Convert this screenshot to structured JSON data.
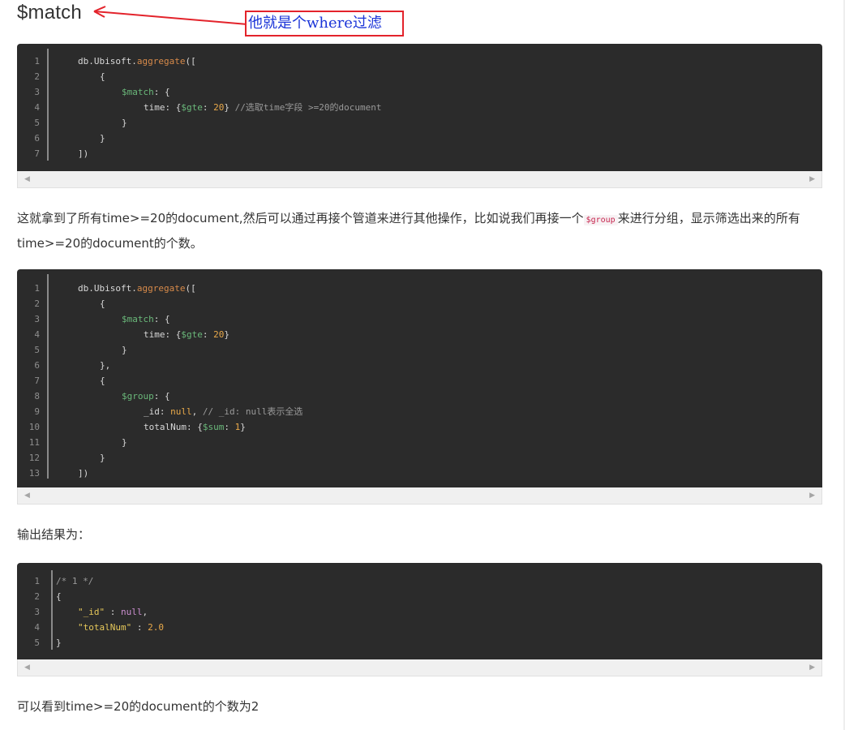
{
  "heading": "$match",
  "annotation": {
    "text": "他就是个where过滤",
    "arrow_color": "#e3232b",
    "text_color": "#1b35d8"
  },
  "code_blocks": [
    {
      "line_numbers": [
        "1",
        "2",
        "3",
        "4",
        "5",
        "6",
        "7"
      ],
      "lines": [
        [
          {
            "t": "db.Ubisoft.",
            "c": "plain"
          },
          {
            "t": "aggregate",
            "c": "func"
          },
          {
            "t": "([",
            "c": "plain"
          }
        ],
        [
          {
            "t": "{",
            "c": "plain"
          }
        ],
        [
          {
            "t": "$match",
            "c": "key"
          },
          {
            "t": ": {",
            "c": "plain"
          }
        ],
        [
          {
            "t": "time: {",
            "c": "plain"
          },
          {
            "t": "$gte",
            "c": "key"
          },
          {
            "t": ": ",
            "c": "plain"
          },
          {
            "t": "20",
            "c": "num"
          },
          {
            "t": "} ",
            "c": "plain"
          },
          {
            "t": "//选取time字段 >=20的document",
            "c": "cmt"
          }
        ],
        [
          {
            "t": "}",
            "c": "plain"
          }
        ],
        [
          {
            "t": "}",
            "c": "plain"
          }
        ],
        [
          {
            "t": "])",
            "c": "plain"
          }
        ]
      ],
      "indent": [
        1,
        2,
        3,
        4,
        3,
        2,
        1
      ]
    },
    {
      "line_numbers": [
        "1",
        "2",
        "3",
        "4",
        "5",
        "6",
        "7",
        "8",
        "9",
        "10",
        "11",
        "12",
        "13"
      ],
      "lines": [
        [
          {
            "t": "db.Ubisoft.",
            "c": "plain"
          },
          {
            "t": "aggregate",
            "c": "func"
          },
          {
            "t": "([",
            "c": "plain"
          }
        ],
        [
          {
            "t": "{",
            "c": "plain"
          }
        ],
        [
          {
            "t": "$match",
            "c": "key"
          },
          {
            "t": ": {",
            "c": "plain"
          }
        ],
        [
          {
            "t": "time: {",
            "c": "plain"
          },
          {
            "t": "$gte",
            "c": "key"
          },
          {
            "t": ": ",
            "c": "plain"
          },
          {
            "t": "20",
            "c": "num"
          },
          {
            "t": "}",
            "c": "plain"
          }
        ],
        [
          {
            "t": "}",
            "c": "plain"
          }
        ],
        [
          {
            "t": "},",
            "c": "plain"
          }
        ],
        [
          {
            "t": "{",
            "c": "plain"
          }
        ],
        [
          {
            "t": "$group",
            "c": "key"
          },
          {
            "t": ": {",
            "c": "plain"
          }
        ],
        [
          {
            "t": "_id: ",
            "c": "plain"
          },
          {
            "t": "null",
            "c": "num"
          },
          {
            "t": ", ",
            "c": "plain"
          },
          {
            "t": "// _id: null表示全选",
            "c": "cmt"
          }
        ],
        [
          {
            "t": "totalNum: {",
            "c": "plain"
          },
          {
            "t": "$sum",
            "c": "key"
          },
          {
            "t": ": ",
            "c": "plain"
          },
          {
            "t": "1",
            "c": "num"
          },
          {
            "t": "}",
            "c": "plain"
          }
        ],
        [
          {
            "t": "}",
            "c": "plain"
          }
        ],
        [
          {
            "t": "}",
            "c": "plain"
          }
        ],
        [
          {
            "t": "])",
            "c": "plain"
          }
        ]
      ],
      "indent": [
        1,
        2,
        3,
        4,
        3,
        2,
        2,
        3,
        4,
        4,
        3,
        2,
        1
      ]
    },
    {
      "line_numbers": [
        "1",
        "2",
        "3",
        "4",
        "5"
      ],
      "lines": [
        [
          {
            "t": "/* 1 */",
            "c": "cmt"
          }
        ],
        [
          {
            "t": "{",
            "c": "plain"
          }
        ],
        [
          {
            "t": "\"_id\"",
            "c": "str"
          },
          {
            "t": " : ",
            "c": "plain"
          },
          {
            "t": "null",
            "c": "null"
          },
          {
            "t": ",",
            "c": "plain"
          }
        ],
        [
          {
            "t": "\"totalNum\"",
            "c": "str"
          },
          {
            "t": " : ",
            "c": "plain"
          },
          {
            "t": "2.0",
            "c": "num"
          }
        ],
        [
          {
            "t": "}",
            "c": "plain"
          }
        ]
      ],
      "indent": [
        0,
        0,
        1,
        1,
        0
      ]
    }
  ],
  "paragraph1": {
    "before": "这就拿到了所有time>=20的document,然后可以通过再接个管道来进行其他操作，比如说我们再接一个",
    "code": "$group",
    "after": "来进行分组，显示筛选出来的所有time>=20的document的个数。"
  },
  "paragraph2": "输出结果为：",
  "paragraph3": "可以看到time>=20的document的个数为2",
  "scroll_arrows": {
    "left": "◀",
    "right": "▶"
  }
}
